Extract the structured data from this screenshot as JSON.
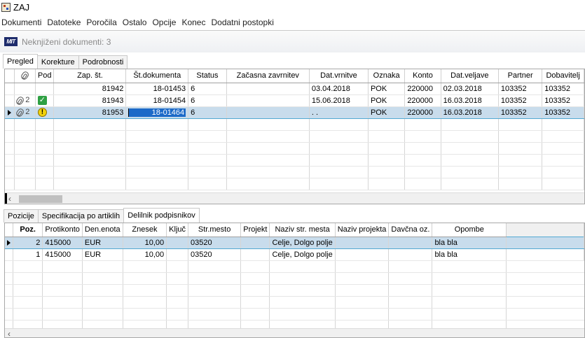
{
  "window": {
    "title": "ZAJ"
  },
  "menu": [
    "Dokumenti",
    "Datoteke",
    "Poročila",
    "Ostalo",
    "Opcije",
    "Konec",
    "Dodatni postopki"
  ],
  "doc_header": {
    "logo_text": "MIT",
    "title": "Neknjiženi dokumenti: 3"
  },
  "top_tabs": [
    {
      "label": "Pregled",
      "active": true
    },
    {
      "label": "Korekture",
      "active": false
    },
    {
      "label": "Podrobnosti",
      "active": false
    }
  ],
  "top_grid": {
    "columns": [
      "",
      "Pod",
      "Zap. št.",
      "Št.dokumenta",
      "Status",
      "Začasna zavrnitev",
      "Dat.vrnitve",
      "Oznaka",
      "Konto",
      "Dat.veljave",
      "Partner",
      "Dobavitelj"
    ],
    "rows": [
      {
        "attachments": "",
        "pod": "",
        "zap_st": "81942",
        "st_dokumenta": "18-01453",
        "status": "6",
        "zacasna": "",
        "dat_vrnitve": "03.04.2018",
        "oznaka": "POK",
        "konto": "220000",
        "dat_veljave": "02.03.2018",
        "partner": "103352",
        "dobavitelj": "103352"
      },
      {
        "attachments": "2",
        "pod": "ok",
        "zap_st": "81943",
        "st_dokumenta": "18-01454",
        "status": "6",
        "zacasna": "",
        "dat_vrnitve": "15.06.2018",
        "oznaka": "POK",
        "konto": "220000",
        "dat_veljave": "16.03.2018",
        "partner": "103352",
        "dobavitelj": "103352"
      },
      {
        "attachments": "2",
        "pod": "warn",
        "zap_st": "81953",
        "st_dokumenta": "18-01464",
        "status": "6",
        "zacasna": "",
        "dat_vrnitve": ". .",
        "oznaka": "POK",
        "konto": "220000",
        "dat_veljave": "16.03.2018",
        "partner": "103352",
        "dobavitelj": "103352"
      }
    ]
  },
  "bottom_tabs": [
    {
      "label": "Pozicije",
      "active": false
    },
    {
      "label": "Specifikacija po artiklih",
      "active": false
    },
    {
      "label": "Delilnik podpisnikov",
      "active": true
    }
  ],
  "bottom_grid": {
    "columns": [
      "Poz.",
      "Protikonto",
      "Den.enota",
      "Znesek",
      "Ključ",
      "Str.mesto",
      "Projekt",
      "Naziv str. mesta",
      "Naziv projekta",
      "Davčna oz.",
      "Opombe"
    ],
    "rows": [
      {
        "poz": "2",
        "protikonto": "415000",
        "den_enota": "EUR",
        "znesek": "10,00",
        "kljuc": "",
        "str_mesto": "03520",
        "projekt": "",
        "naziv_str_mesta": "Celje, Dolgo polje",
        "naziv_projekta": "",
        "davcna_oz": "",
        "opombe": "bla bla"
      },
      {
        "poz": "1",
        "protikonto": "415000",
        "den_enota": "EUR",
        "znesek": "10,00",
        "kljuc": "",
        "str_mesto": "03520",
        "projekt": "",
        "naziv_str_mesta": "Celje, Dolgo polje",
        "naziv_projekta": "",
        "davcna_oz": "",
        "opombe": "bla bla"
      }
    ]
  },
  "colors": {
    "selected_row": "#c8dcec",
    "selected_border": "#53a9d2",
    "edit_cell": "#1c6ac8"
  }
}
